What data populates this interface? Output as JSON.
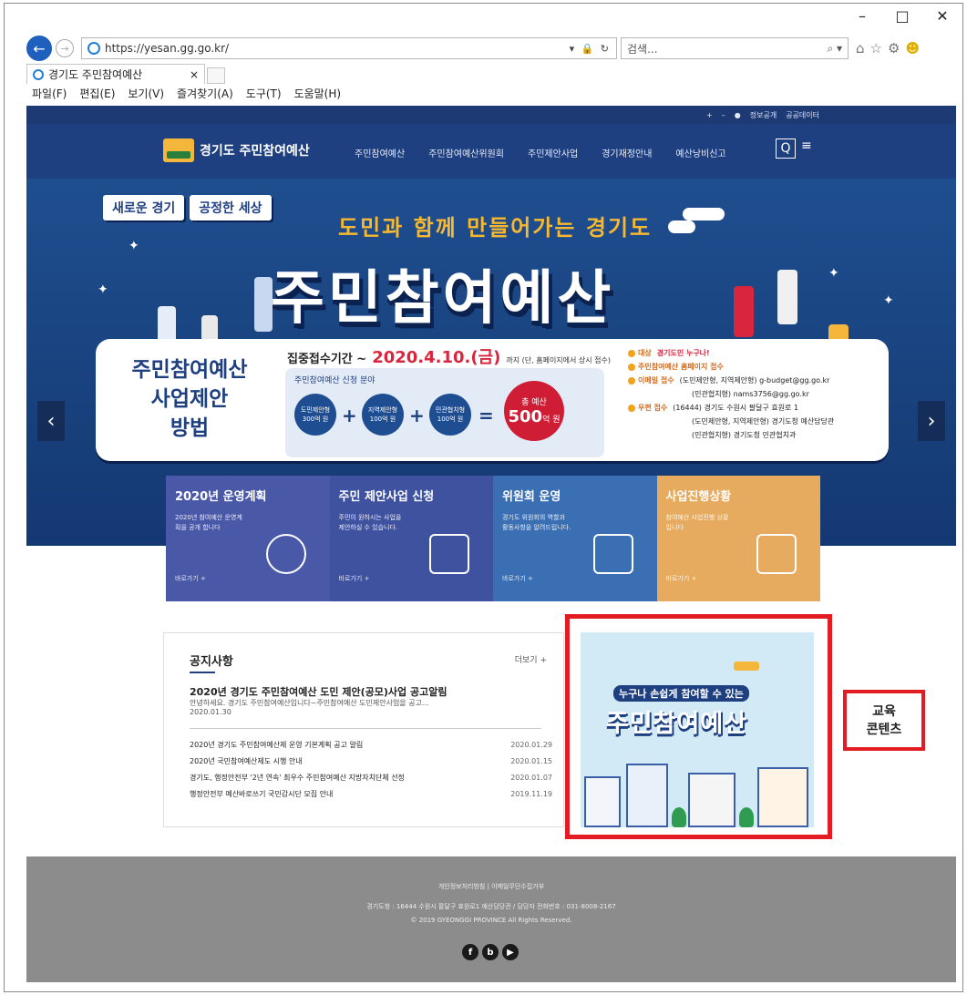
{
  "window": {
    "minimize": "–",
    "maximize": "□",
    "close": "✕"
  },
  "browser": {
    "url": "https://yesan.gg.go.kr/",
    "addr_tools": "▾ 🔒 ↻",
    "search_placeholder": "검색...",
    "search_tool": "⌕ ▾",
    "tab_title": "경기도 주민참여예산",
    "tab_close": "×",
    "menu": [
      "파일(F)",
      "편집(E)",
      "보기(V)",
      "즐겨찾기(A)",
      "도구(T)",
      "도움말(H)"
    ],
    "icons": [
      "home-icon",
      "star-icon",
      "gear-icon",
      "smiley-icon"
    ]
  },
  "site": {
    "topbar": {
      "plus": "+",
      "minus": "–",
      "dot": "●",
      "info": "정보공개",
      "data": "공공데이터"
    },
    "logo": "경기도 주민참여예산",
    "menu": [
      "주민참여예산",
      "주민참여예산위원회",
      "주민제안사업",
      "경기재정안내",
      "예산낭비신고"
    ],
    "search_icon": "Q",
    "menu_icon": "≡",
    "hero": {
      "slogan1": "새로운 경기",
      "slogan2": "공정한 세상",
      "tagline": "도민과 함께 만들어가는 경기도",
      "title": "주민참여예산",
      "prev": "‹",
      "next": "›"
    },
    "card": {
      "title1": "주민참여예산",
      "title2": "사업제안",
      "title3": "방법",
      "period_label": "집중접수기간 ~",
      "period_date": "2020.4.10.(금)",
      "period_note": "까지 (단, 홈페이지에서 상시 접수)",
      "field_label": "주민참여예산 신청 분야",
      "fields": [
        {
          "name": "도민제안형",
          "amount": "300억 원"
        },
        {
          "name": "지역제안형",
          "amount": "100억 원"
        },
        {
          "name": "민관협치형",
          "amount": "100억 원"
        }
      ],
      "plus": "+",
      "equals": "=",
      "total_label": "총 예산",
      "total_value": "500",
      "total_unit": "억 원",
      "target_label": "대상",
      "target_value": "경기도민 누구나!",
      "home_label": "주민참여예산 홈페이지 접수",
      "email_label": "이메일 접수",
      "email_1": "(도민제안형, 지역제안형) g-budget@gg.go.kr",
      "email_2": "(민관협치형) nams3756@gg.go.kr",
      "post_label": "우편 접수",
      "post_1": "(16444) 경기도 수원시 팔달구 효원로 1",
      "post_2": "(도민제안형, 지역제안형) 경기도청 예산담당관",
      "post_3": "(민관협치형) 경기도청 민관협치과"
    },
    "tiles": [
      {
        "title": "2020년 운영계획",
        "desc": "2020년 참여예산 운영계획을 공개 합니다",
        "more": "바로가기 +",
        "color": "#4a58a8"
      },
      {
        "title": "주민 제안사업 신청",
        "desc": "주민이 원하시는 사업을 제안하실 수 있습니다.",
        "more": "바로가기 +",
        "color": "#3f52a0"
      },
      {
        "title": "위원회 운영",
        "desc": "경기도 위원회의 역할과 활동사항을 알려드립니다.",
        "more": "바로가기 +",
        "color": "#3a6fb4"
      },
      {
        "title": "사업진행상황",
        "desc": "참여예산 사업진행 상황 입니다",
        "more": "바로가기 +",
        "color": "#e6ab5e"
      }
    ],
    "notice": {
      "heading": "공지사항",
      "more": "더보기 +",
      "featured_title": "2020년 경기도 주민참여예산 도민 제안(공모)사업 공고알림",
      "featured_summary": "안녕하세요. 경기도 주민참여예산입니다~주민참여예산 도민제안사업을 공고...",
      "featured_date": "2020.01.30",
      "items": [
        {
          "title": "2020년 경기도 주민참여예산제 운영 기본계획 공고 알림",
          "date": "2020.01.29"
        },
        {
          "title": "2020년 국민참여예산제도 시행 안내",
          "date": "2020.01.15"
        },
        {
          "title": "경기도, 행정안전부 '2년 연속' 최우수 주민참여예산 지방자치단체 선정",
          "date": "2020.01.07"
        },
        {
          "title": "행정안전부 예산바로쓰기 국민감시단 모집 안내",
          "date": "2019.11.19"
        }
      ]
    },
    "banner": {
      "line1": "누구나 손쉽게 참여할 수 있는",
      "line2": "주민참여예산"
    },
    "annotation": {
      "line1": "교육",
      "line2": "콘텐츠"
    },
    "footer": {
      "links": "개인정보처리방침 | 이메일무단수집거부",
      "address": "경기도청 : 16444 수원시 팔달구 효원로1 예산담당관 / 담당자 전화번호 : 031-8008-2167",
      "copyright": "© 2019 GYEONGGI PROVINCE All Rights Reserved.",
      "social": [
        "f",
        "b",
        "▶"
      ]
    }
  }
}
